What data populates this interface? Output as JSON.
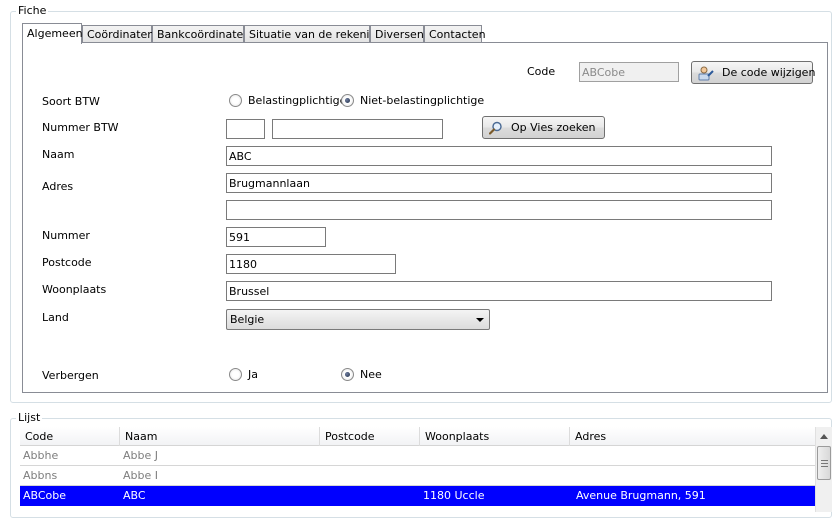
{
  "fiche": {
    "legend": "Fiche",
    "tabs": [
      {
        "label": "Algemeen",
        "active": true
      },
      {
        "label": "Coördinaten",
        "active": false
      },
      {
        "label": "Bankcoördinaten",
        "active": false
      },
      {
        "label": "Situatie van de rekening",
        "active": false
      },
      {
        "label": "Diversen",
        "active": false
      },
      {
        "label": "Contacten",
        "active": false
      }
    ],
    "code": {
      "label": "Code",
      "value": "ABCobe"
    },
    "change_code_button": "De code wijzigen",
    "soort_btw": {
      "label": "Soort BTW",
      "option_1": "Belastingplichtige",
      "option_2": "Niet-belastingplichtige",
      "selected": "Niet-belastingplichtige"
    },
    "nummer_btw": {
      "label": "Nummer BTW",
      "prefix": "",
      "number": ""
    },
    "vies_button": "Op Vies zoeken",
    "naam": {
      "label": "Naam",
      "value": "ABC"
    },
    "adres": {
      "label": "Adres",
      "line1": "Brugmannlaan",
      "line2": ""
    },
    "nummer": {
      "label": "Nummer",
      "value": "591"
    },
    "postcode": {
      "label": "Postcode",
      "value": "1180"
    },
    "woonplaats": {
      "label": "Woonplaats",
      "value": "Brussel"
    },
    "land": {
      "label": "Land",
      "value": "Belgie"
    },
    "verbergen": {
      "label": "Verbergen",
      "option_1": "Ja",
      "option_2": "Nee",
      "selected": "Nee"
    }
  },
  "lijst": {
    "legend": "Lijst",
    "columns": [
      "Code",
      "Naam",
      "Postcode",
      "Woonplaats",
      "Adres"
    ],
    "rows": [
      {
        "code": "Abbhe",
        "naam": "Abbe J",
        "postcode": "",
        "woonplaats": "",
        "adres": "",
        "state": "dim"
      },
      {
        "code": "Abbns",
        "naam": "Abbe I",
        "postcode": "",
        "woonplaats": "",
        "adres": "",
        "state": "dim"
      },
      {
        "code": "ABCobe",
        "naam": "ABC",
        "postcode": "",
        "woonplaats": "1180 Uccle",
        "adres": "Avenue Brugmann, 591",
        "state": "selected"
      }
    ]
  },
  "icons": {
    "change_code": "person-card-icon",
    "vies": "magnifier-icon",
    "dropdown": "chevron-down-icon"
  },
  "colors": {
    "selection": "#0000ff",
    "group_border": "#d5dfe5",
    "tab_border": "#898c95"
  }
}
